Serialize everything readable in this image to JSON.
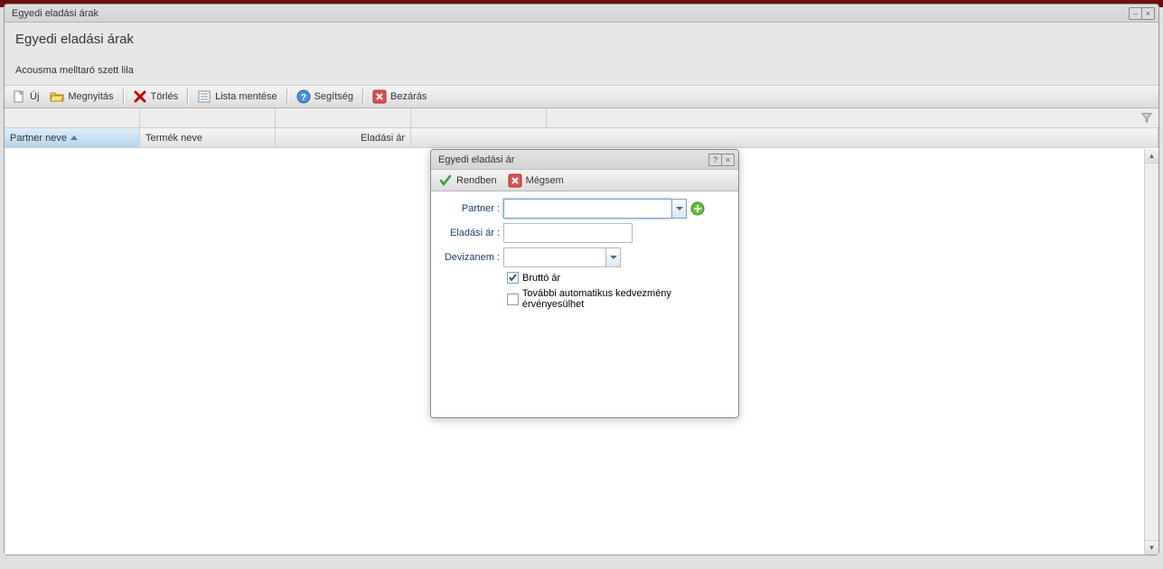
{
  "window": {
    "title": "Egyedi eladási árak"
  },
  "header": {
    "title": "Egyedi eladási árak",
    "subtitle": "Acousma melltaró szett lila"
  },
  "toolbar": {
    "new": "Új",
    "open": "Megnyitás",
    "delete": "Törlés",
    "save_list": "Lista mentése",
    "help": "Segítség",
    "close": "Bezárás"
  },
  "grid": {
    "columns": {
      "partner_name": "Partner neve",
      "product_name": "Termék neve",
      "sale_price": "Eladási ár"
    }
  },
  "dialog": {
    "title": "Egyedi eladási ár",
    "ok": "Rendben",
    "cancel": "Mégsem",
    "labels": {
      "partner": "Partner :",
      "sale_price": "Eladási ár :",
      "currency": "Devizanem :",
      "gross": "Bruttó ár",
      "further_discount": "További automatikus kedvezmény érvényesülhet"
    },
    "values": {
      "partner": "",
      "sale_price": "",
      "currency": "",
      "gross_checked": true,
      "further_discount_checked": false
    }
  }
}
